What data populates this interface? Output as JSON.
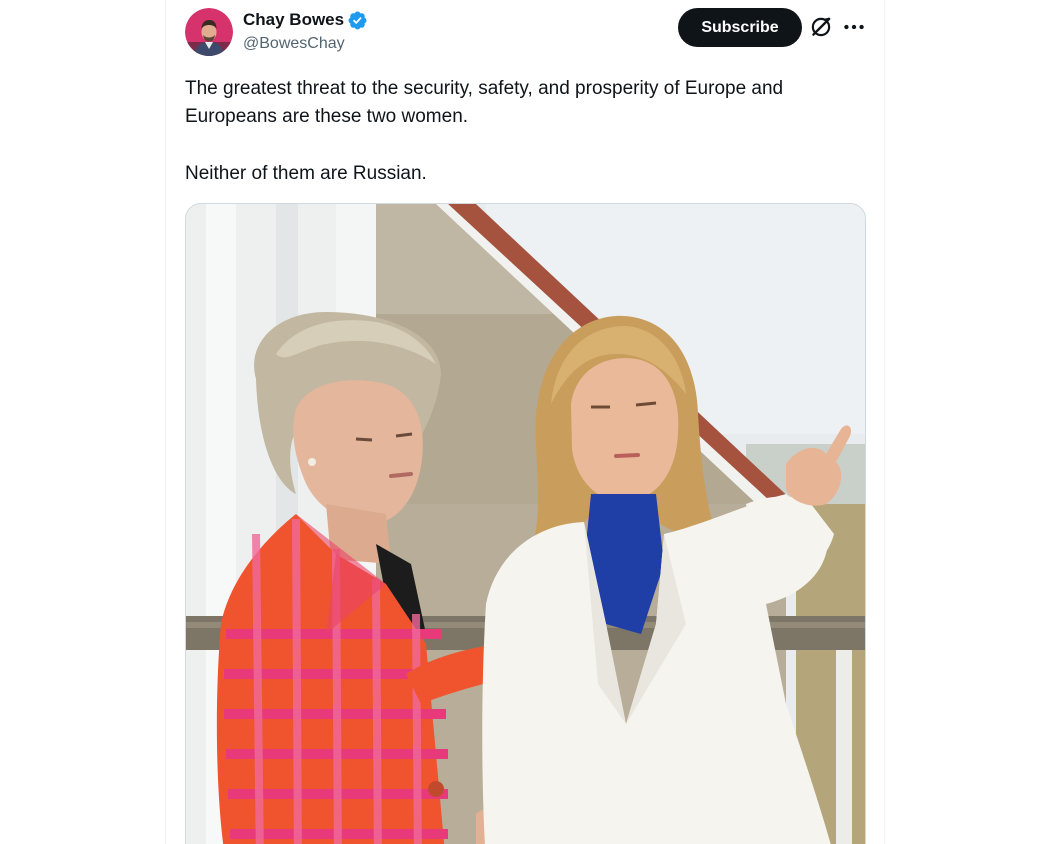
{
  "tweet": {
    "author": {
      "display_name": "Chay Bowes",
      "handle": "@BowesChay",
      "verified": true
    },
    "actions": {
      "subscribe_label": "Subscribe",
      "grok_icon": "grok-icon",
      "more_icon": "more-icon"
    },
    "text": {
      "paragraph_1": "The greatest threat to the security, safety, and prosperity of Europe and Europeans are these two women.",
      "paragraph_2": "Neither of them are Russian."
    },
    "media": {
      "type": "photo"
    }
  },
  "colors": {
    "primary_text": "#0f1419",
    "secondary_text": "#536471",
    "verified_blue": "#1d9bf0",
    "subscribe_bg": "#0f1419",
    "border": "#cfd9de"
  }
}
